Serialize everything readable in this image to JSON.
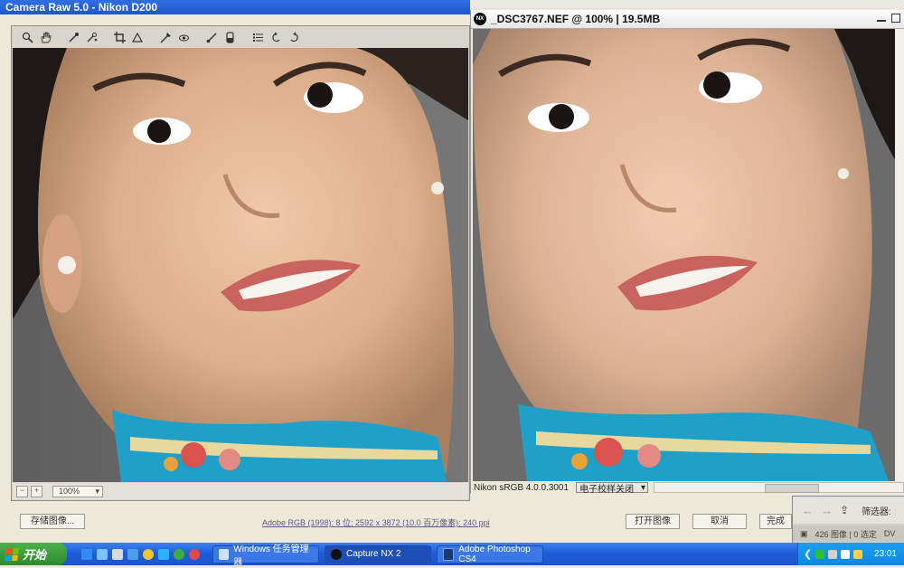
{
  "camera_raw": {
    "title": "Camera Raw 5.0 -  Nikon D200",
    "tools": [
      "zoom-icon",
      "hand-icon",
      "white-balance-icon",
      "color-sampler-icon",
      "crop-icon",
      "straighten-icon",
      "spot-removal-icon",
      "red-eye-icon",
      "adjustment-brush-icon",
      "graduated-filter-icon",
      "preferences-icon",
      "rotate-left-icon",
      "rotate-right-icon"
    ],
    "zoom_minus": "−",
    "zoom_plus": "+",
    "zoom_value": "100%",
    "save_button": "存储图像...",
    "workflow_info": "Adobe RGB (1998); 8 位; 2592 x 3872 (10.0 百万像素); 240 ppi",
    "open_button": "打开图像",
    "cancel_button": "取消",
    "done_button": "完成"
  },
  "capture_nx": {
    "logo_text": "NX",
    "title": "_DSC3767.NEF @ 100% | 19.5MB",
    "profile": "Nikon sRGB 4.0.0.3001",
    "proof_option": "电子校样关闭"
  },
  "bridge": {
    "filter_label": "筛选器:",
    "status": "426 图像 | 0 选定",
    "status_tail": "DV"
  },
  "taskbar": {
    "start_label": "开始",
    "tasks": [
      {
        "label": "Windows 任务管理器"
      },
      {
        "label": "Capture NX 2"
      },
      {
        "label": "Adobe Photoshop CS4"
      }
    ],
    "clock": "23:01"
  },
  "colors": {
    "xp_blue": "#2f6fe6",
    "start_green": "#3ea53e",
    "tray_blue": "#1aa0f0",
    "dress_turquoise": "#1fa0c8"
  }
}
